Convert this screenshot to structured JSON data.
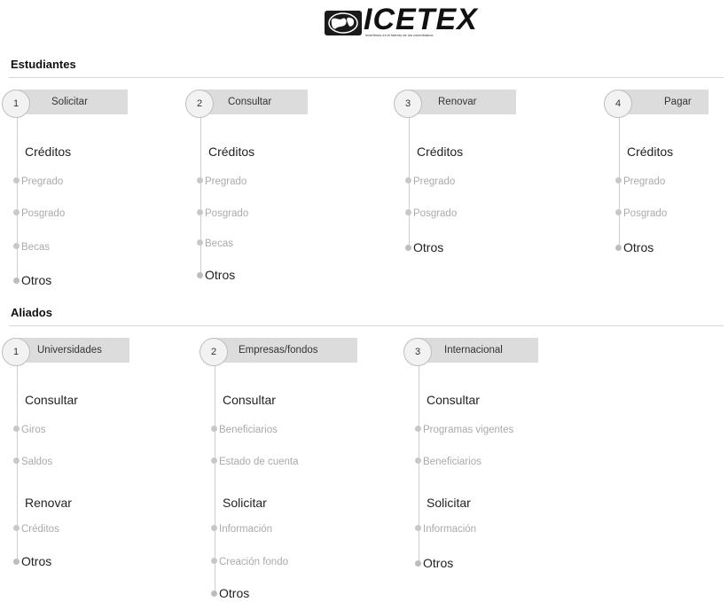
{
  "header": {
    "logo_text": "ICETEX",
    "tagline": "invertimos en el talento de los colombianos"
  },
  "estudiantes": {
    "title": "Estudiantes",
    "steps": [
      {
        "number": "1",
        "label": "Solicitar",
        "head": "Créditos",
        "items": [
          "Pregrado",
          "Posgrado",
          "Becas"
        ],
        "otros": "Otros"
      },
      {
        "number": "2",
        "label": "Consultar",
        "head": "Créditos",
        "items": [
          "Pregrado",
          "Posgrado",
          "Becas"
        ],
        "otros": "Otros"
      },
      {
        "number": "3",
        "label": "Renovar",
        "head": "Créditos",
        "items": [
          "Pregrado",
          "Posgrado"
        ],
        "otros": "Otros"
      },
      {
        "number": "4",
        "label": "Pagar",
        "head": "Créditos",
        "items": [
          "Pregrado",
          "Posgrado"
        ],
        "otros": "Otros"
      }
    ]
  },
  "aliados": {
    "title": "Aliados",
    "steps": [
      {
        "number": "1",
        "label": "Universidades",
        "groups": [
          {
            "head": "Consultar",
            "items": [
              "Giros",
              "Saldos"
            ]
          },
          {
            "head": "Renovar",
            "items": [
              "Créditos"
            ]
          }
        ],
        "otros": "Otros"
      },
      {
        "number": "2",
        "label": "Empresas/fondos",
        "groups": [
          {
            "head": "Consultar",
            "items": [
              "Beneficiarios",
              "Estado de cuenta"
            ]
          },
          {
            "head": "Solicitar",
            "items": [
              "Información",
              "Creación fondo"
            ]
          }
        ],
        "otros": "Otros"
      },
      {
        "number": "3",
        "label": "Internacional",
        "groups": [
          {
            "head": "Consultar",
            "items": [
              "Programas vigentes",
              "Beneficiarios"
            ]
          },
          {
            "head": "Solicitar",
            "items": [
              "Información"
            ]
          }
        ],
        "otros": "Otros"
      }
    ]
  }
}
